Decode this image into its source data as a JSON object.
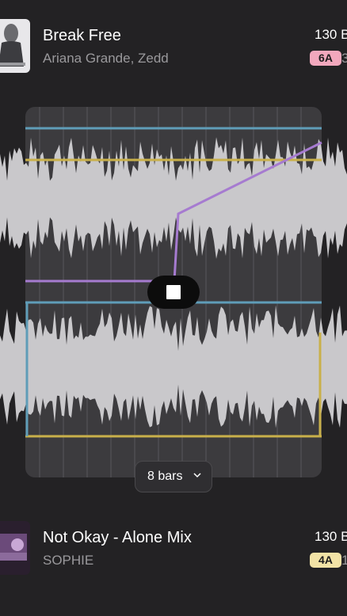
{
  "tracks": [
    {
      "title": "Break Free",
      "artist": "Ariana Grande, Zedd",
      "bpm": "130 B",
      "key": "6A",
      "key_extra": "3",
      "key_color": "#f2a8bd"
    },
    {
      "title": "Not Okay - Alone Mix",
      "artist": "SOPHIE",
      "bpm": "130 B",
      "key": "4A",
      "key_extra": "1",
      "key_color": "#f2e3a6"
    }
  ],
  "editor": {
    "bars_label": "8 bars",
    "accent_colors": {
      "blue": "#5f9db8",
      "yellow": "#c9b04a",
      "purple": "#a67bd0",
      "waveform": "#c9c8cb"
    }
  }
}
